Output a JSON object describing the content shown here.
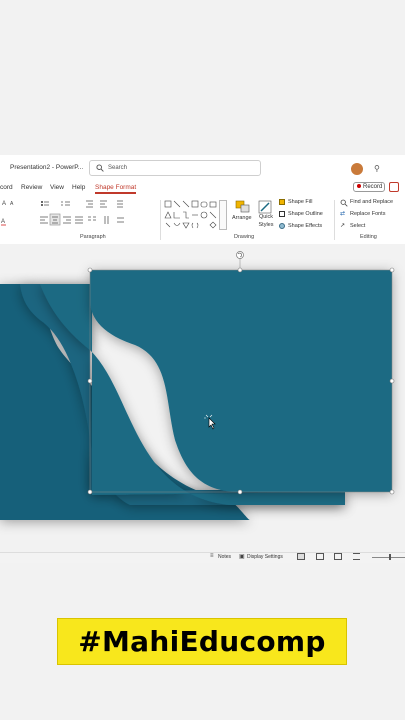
{
  "window": {
    "title": "Presentation2 - PowerP...",
    "search_placeholder": "Search",
    "record_label": "Record"
  },
  "tabs": [
    {
      "label": "cord"
    },
    {
      "label": "Review"
    },
    {
      "label": "View"
    },
    {
      "label": "Help"
    },
    {
      "label": "Shape Format",
      "active": true
    }
  ],
  "ribbon": {
    "paragraph_label": "Paragraph",
    "drawing_label": "Drawing",
    "editing_label": "Editing",
    "arrange_label": "Arrange",
    "quick_styles_label": "Quick Styles",
    "shape_fill": "Shape Fill",
    "shape_outline": "Shape Outline",
    "shape_effects": "Shape Effects",
    "find_replace": "Find and Replace",
    "replace_fonts": "Replace Fonts",
    "select": "Select"
  },
  "status": {
    "notes": "Notes",
    "display_settings": "Display Settings"
  },
  "banner": {
    "text": "#MahiEducomp"
  },
  "colors": {
    "slide_teal": "#1b6a83",
    "accent_red": "#c0392b",
    "banner_yellow": "#f8e71c"
  }
}
